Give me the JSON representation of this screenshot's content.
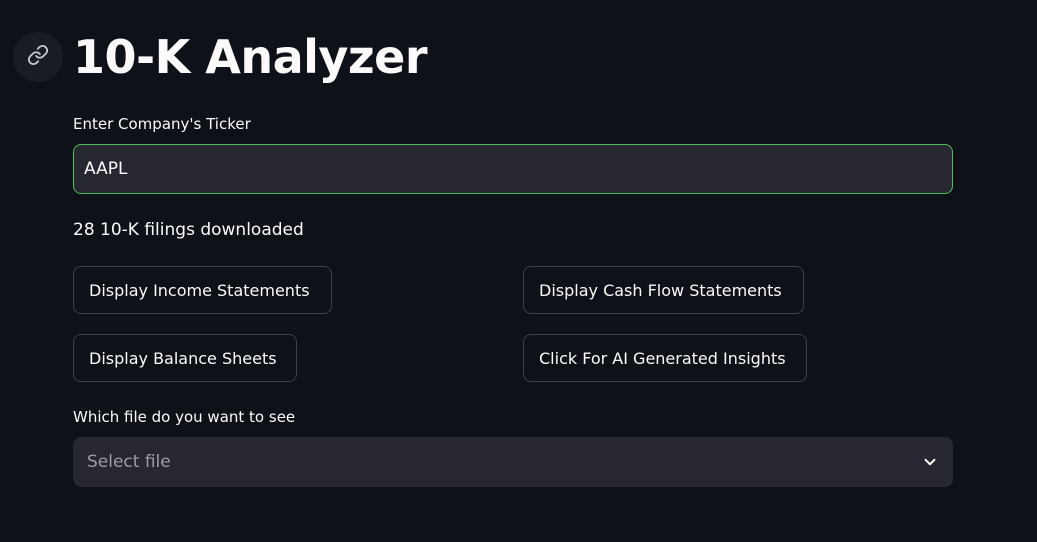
{
  "header": {
    "title": "10-K Analyzer",
    "link_icon": "link-icon"
  },
  "ticker": {
    "label": "Enter Company's Ticker",
    "value": "AAPL"
  },
  "status": {
    "text": "28 10-K filings downloaded"
  },
  "buttons": {
    "income": "Display Income Statements",
    "cash_flow": "Display Cash Flow Statements",
    "balance": "Display Balance Sheets",
    "ai_insights": "Click For AI Generated Insights"
  },
  "file_select": {
    "label": "Which file do you want to see",
    "placeholder": "Select file",
    "icon": "chevron-down-icon"
  },
  "colors": {
    "background": "#0e1117",
    "input_bg": "#262730",
    "focus_border": "#4dbd57",
    "button_border": "#3e4049",
    "text": "#fafafa",
    "placeholder": "#9b9ca4"
  }
}
